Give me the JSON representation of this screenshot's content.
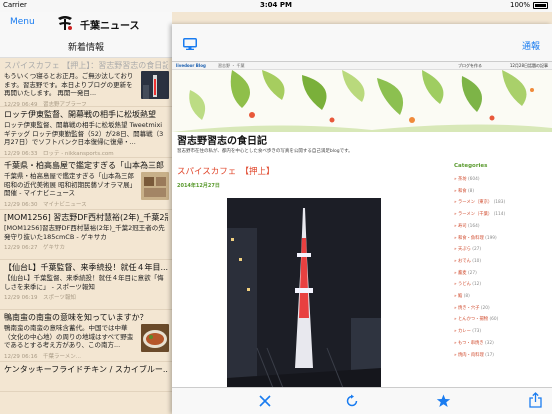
{
  "status": {
    "carrier": "Carrier",
    "time": "3:04 PM",
    "battery": "100%"
  },
  "left": {
    "menu_label": "Menu",
    "app_title": "千葉ニュース",
    "section_title": "新着情報",
    "items": [
      {
        "title": "スパイスカフェ 【押上】：習志野習志の食日記",
        "body": "もういくつ寝るとお正月。ご無沙汰しております。習志野です。本日よりブログの更新を再開いたします。 再開一発目...",
        "meta": "12/29 06:49　習志野アブラーフ"
      },
      {
        "title": "ロッテ伊東監督、開幕戦の相手に松坂熱望",
        "body": "ロッテ伊東監督、開幕戦の相手に松坂熱望 Tweetmixiギテッグ ロッテ伊東勤監督（52）が28日、開幕戦（3月27日）でソフトバンク日本復帰に復帰・...",
        "meta": "12/29 06:33　ロッテ - nikkansports.com"
      },
      {
        "title": "千葉県・柏高島屋で鑑定すぎる「山本為三郎",
        "body": "千葉県・柏高島屋で鑑定すぎる「山本為三郎 昭和の近代美術展 昭和初期民藝ゾオラマ展」開催 - マイナビニュース",
        "meta": "12/29 06:30　マイナビニュース"
      },
      {
        "title": "[MOM1256] 習志野DF西村慧裕(2年)_千葉2冠...",
        "body": "[MOM1256]習志野DF西村慧裕(2年)_千葉2冠王者の先発守り抜いた185cmCB - ゲキサカ",
        "meta": "12/29 06:27　ゲキサカ"
      },
      {
        "title": "【仙台L】千葉監督、来季続投！就任４年目...",
        "body": "【仙台L】千葉監督、来季続投！就任４年目に意欲「悔しさを来季に」 - スポーツ報知",
        "meta": "12/29 06:19　スポーツ報知"
      },
      {
        "title": "鴨南蛮の南蛮の意味を知っていますか？",
        "body": "鴨南蛮の南蛮の意味含蓄代。中国では中華（文化の中心地）の周りの地域はすべて野蛮であるとする考え方があり、この南方...",
        "meta": "12/29 06:16　千葉ラーメン..."
      },
      {
        "title": "ケンタッキーフライドチキン / スカイブルー...",
        "body": "",
        "meta": ""
      }
    ]
  },
  "right": {
    "tsuho_label": "通報",
    "blog": {
      "brand": "livedoor Blog",
      "nav_text": "習志野 ・ 千葉",
      "topbar_right_1": "ブログを作る",
      "topbar_right_2": "12月28日話題の記事",
      "title": "習志野習志の食日記",
      "subtitle": "習志野市在住の私が、都内を中心とした食べ歩きの写真を公開する自己満足blogです。",
      "post_title": "スパイスカフェ　【押上】",
      "post_date": "2014年12月27日",
      "categories_title": "Categories",
      "categories": [
        {
          "name": "茶坊",
          "count": "(604)"
        },
        {
          "name": "和食",
          "count": "(8)"
        },
        {
          "name": "ラーメン（東京）",
          "count": "(183)"
        },
        {
          "name": "ラーメン（千葉）",
          "count": "(114)"
        },
        {
          "name": "寿司",
          "count": "(164)"
        },
        {
          "name": "和食・魚料理",
          "count": "(199)"
        },
        {
          "name": "天ぷら",
          "count": "(27)"
        },
        {
          "name": "おでん",
          "count": "(10)"
        },
        {
          "name": "蕎麦",
          "count": "(27)"
        },
        {
          "name": "うどん",
          "count": "(12)"
        },
        {
          "name": "鮨",
          "count": "(8)"
        },
        {
          "name": "焼き・穴子",
          "count": "(20)"
        },
        {
          "name": "とんかつ・揚物",
          "count": "(60)"
        },
        {
          "name": "カレー",
          "count": "(73)"
        },
        {
          "name": "もつ・串焼き",
          "count": "(32)"
        },
        {
          "name": "焼肉・肉料理",
          "count": "(17)"
        }
      ]
    }
  },
  "colors": {
    "accent": "#1a7cf0",
    "panel_bg": "#f3e6d2",
    "post_red": "#e0452a",
    "category_green": "#5a9a2e"
  }
}
